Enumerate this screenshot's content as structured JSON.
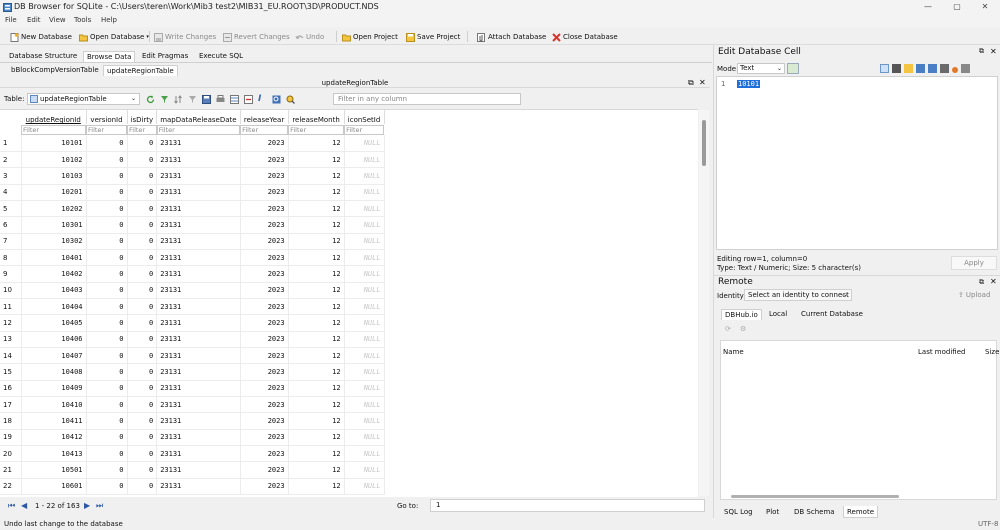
{
  "window": {
    "title": "DB Browser for SQLite - C:\\Users\\teren\\Work\\Mib3 test2\\MIB31_EU.ROOT\\3D\\PRODUCT.NDS"
  },
  "menu": [
    "File",
    "Edit",
    "View",
    "Tools",
    "Help"
  ],
  "toolbar": {
    "new_db": "New Database",
    "open_db": "Open Database",
    "write": "Write Changes",
    "revert": "Revert Changes",
    "undo": "Undo",
    "open_project": "Open Project",
    "save_project": "Save Project",
    "attach": "Attach Database",
    "close_db": "Close Database"
  },
  "main_tabs": [
    "Database Structure",
    "Browse Data",
    "Edit Pragmas",
    "Execute SQL"
  ],
  "sub_tabs": [
    "bBlockCompVersionTable",
    "updateRegionTable"
  ],
  "dock_title": "updateRegionTable",
  "table_bar": {
    "label": "Table:",
    "selected": "updateRegionTable",
    "filter_placeholder": "Filter in any column"
  },
  "grid": {
    "columns": [
      "updateRegionId",
      "versionId",
      "isDirty",
      "mapDataReleaseDate",
      "releaseYear",
      "releaseMonth",
      "iconSetId"
    ],
    "filter_placeholder": "Filter",
    "rows": [
      [
        "1",
        "10101",
        "0",
        "0",
        "23131",
        "2023",
        "12",
        "NULL"
      ],
      [
        "2",
        "10102",
        "0",
        "0",
        "23131",
        "2023",
        "12",
        "NULL"
      ],
      [
        "3",
        "10103",
        "0",
        "0",
        "23131",
        "2023",
        "12",
        "NULL"
      ],
      [
        "4",
        "10201",
        "0",
        "0",
        "23131",
        "2023",
        "12",
        "NULL"
      ],
      [
        "5",
        "10202",
        "0",
        "0",
        "23131",
        "2023",
        "12",
        "NULL"
      ],
      [
        "6",
        "10301",
        "0",
        "0",
        "23131",
        "2023",
        "12",
        "NULL"
      ],
      [
        "7",
        "10302",
        "0",
        "0",
        "23131",
        "2023",
        "12",
        "NULL"
      ],
      [
        "8",
        "10401",
        "0",
        "0",
        "23131",
        "2023",
        "12",
        "NULL"
      ],
      [
        "9",
        "10402",
        "0",
        "0",
        "23131",
        "2023",
        "12",
        "NULL"
      ],
      [
        "10",
        "10403",
        "0",
        "0",
        "23131",
        "2023",
        "12",
        "NULL"
      ],
      [
        "11",
        "10404",
        "0",
        "0",
        "23131",
        "2023",
        "12",
        "NULL"
      ],
      [
        "12",
        "10405",
        "0",
        "0",
        "23131",
        "2023",
        "12",
        "NULL"
      ],
      [
        "13",
        "10406",
        "0",
        "0",
        "23131",
        "2023",
        "12",
        "NULL"
      ],
      [
        "14",
        "10407",
        "0",
        "0",
        "23131",
        "2023",
        "12",
        "NULL"
      ],
      [
        "15",
        "10408",
        "0",
        "0",
        "23131",
        "2023",
        "12",
        "NULL"
      ],
      [
        "16",
        "10409",
        "0",
        "0",
        "23131",
        "2023",
        "12",
        "NULL"
      ],
      [
        "17",
        "10410",
        "0",
        "0",
        "23131",
        "2023",
        "12",
        "NULL"
      ],
      [
        "18",
        "10411",
        "0",
        "0",
        "23131",
        "2023",
        "12",
        "NULL"
      ],
      [
        "19",
        "10412",
        "0",
        "0",
        "23131",
        "2023",
        "12",
        "NULL"
      ],
      [
        "20",
        "10413",
        "0",
        "0",
        "23131",
        "2023",
        "12",
        "NULL"
      ],
      [
        "21",
        "10501",
        "0",
        "0",
        "23131",
        "2023",
        "12",
        "NULL"
      ],
      [
        "22",
        "10601",
        "0",
        "0",
        "23131",
        "2023",
        "12",
        "NULL"
      ]
    ]
  },
  "nav": {
    "range": "1 - 22 of 163",
    "goto_label": "Go to:",
    "goto_value": "1"
  },
  "status": {
    "left": "Undo last change to the database",
    "encoding": "UTF-8"
  },
  "edit_cell": {
    "title": "Edit Database Cell",
    "mode_label": "Mode:",
    "mode_value": "Text",
    "line_no": "1",
    "value": "10101",
    "info_line1": "Editing row=1, column=0",
    "info_line2": "Type: Text / Numeric; Size: 5 character(s)",
    "apply": "Apply"
  },
  "remote": {
    "title": "Remote",
    "identity_label": "Identity",
    "identity_value": "Select an identity to connect",
    "upload": "Upload",
    "tabs": [
      "DBHub.io",
      "Local",
      "Current Database"
    ],
    "columns": [
      "Name",
      "Last modified",
      "Size"
    ]
  },
  "bottom_tabs": [
    "SQL Log",
    "Plot",
    "DB Schema",
    "Remote"
  ]
}
